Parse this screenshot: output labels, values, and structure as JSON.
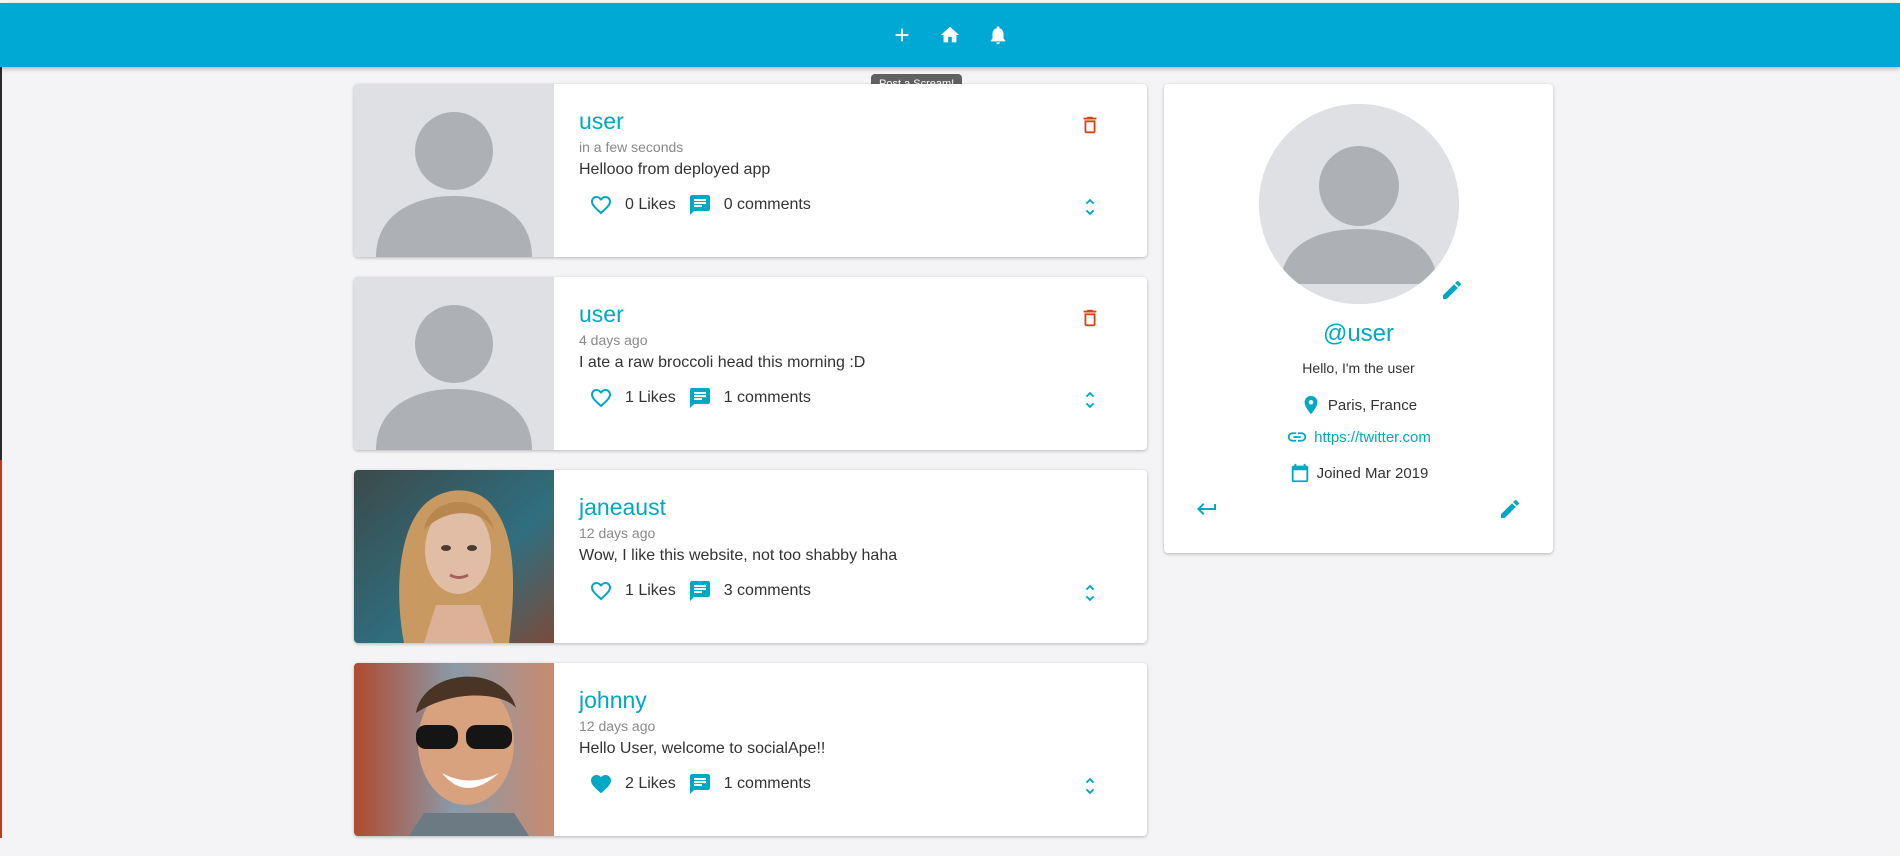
{
  "navbar": {
    "tooltip": "Post a Scream!",
    "buttons": [
      {
        "icon": "add-icon"
      },
      {
        "icon": "home-icon"
      },
      {
        "icon": "bell-icon"
      }
    ],
    "color": "#00a8d4"
  },
  "feed": {
    "posts": [
      {
        "user": "user",
        "time": "in a few seconds",
        "body": "Hellooo from deployed app",
        "likes": "0 Likes",
        "comments": "0 comments",
        "liked": false,
        "deletable": true,
        "avatar": "placeholder"
      },
      {
        "user": "user",
        "time": "4 days ago",
        "body": "I ate a raw broccoli head this morning :D",
        "likes": "1 Likes",
        "comments": "1 comments",
        "liked": false,
        "deletable": true,
        "avatar": "placeholder"
      },
      {
        "user": "janeaust",
        "time": "12 days ago",
        "body": "Wow, I like this website, not too shabby haha",
        "likes": "1 Likes",
        "comments": "3 comments",
        "liked": false,
        "deletable": false,
        "avatar": "photo-woman"
      },
      {
        "user": "johnny",
        "time": "12 days ago",
        "body": "Hello User, welcome to socialApe!!",
        "likes": "2 Likes",
        "comments": "1 comments",
        "liked": true,
        "deletable": false,
        "avatar": "photo-man"
      }
    ]
  },
  "profile": {
    "handle": "@user",
    "bio": "Hello, I'm the user",
    "location": "Paris, France",
    "website": "https://twitter.com",
    "joined": "Joined Mar 2019"
  },
  "colors": {
    "accent": "#00a8c4",
    "delete": "#d84315"
  }
}
